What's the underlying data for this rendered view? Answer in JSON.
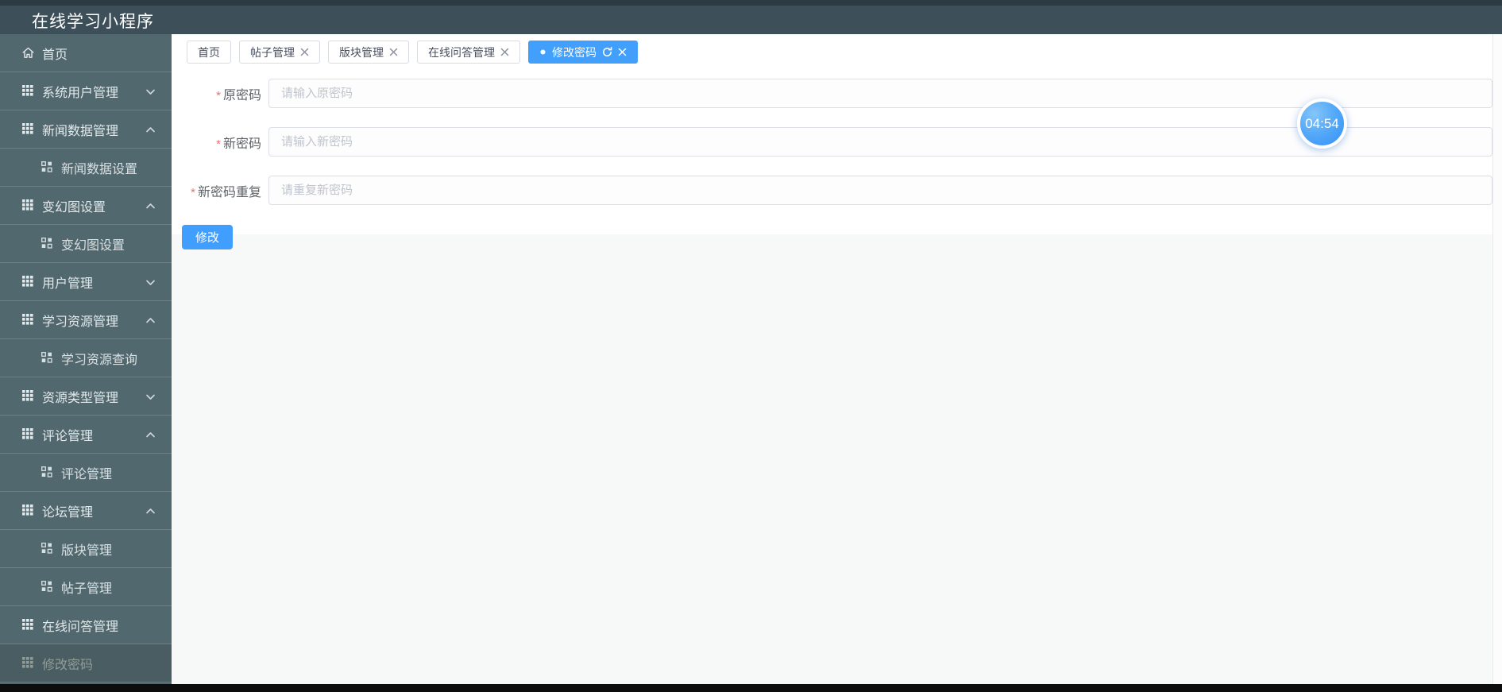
{
  "header": {
    "title": "在线学习小程序"
  },
  "sidebar": {
    "items": [
      {
        "label": "首页",
        "icon": "home",
        "chevron": "",
        "sub": false,
        "dimmed": false
      },
      {
        "label": "系统用户管理",
        "icon": "grid",
        "chevron": "down",
        "sub": false,
        "dimmed": false
      },
      {
        "label": "新闻数据管理",
        "icon": "grid",
        "chevron": "up",
        "sub": false,
        "dimmed": false
      },
      {
        "label": "新闻数据设置",
        "icon": "subgrid",
        "chevron": "",
        "sub": true,
        "dimmed": false
      },
      {
        "label": "变幻图设置",
        "icon": "grid",
        "chevron": "up",
        "sub": false,
        "dimmed": false
      },
      {
        "label": "变幻图设置",
        "icon": "subgrid",
        "chevron": "",
        "sub": true,
        "dimmed": false
      },
      {
        "label": "用户管理",
        "icon": "grid",
        "chevron": "down",
        "sub": false,
        "dimmed": false
      },
      {
        "label": "学习资源管理",
        "icon": "grid",
        "chevron": "up",
        "sub": false,
        "dimmed": false
      },
      {
        "label": "学习资源查询",
        "icon": "subgrid",
        "chevron": "",
        "sub": true,
        "dimmed": false
      },
      {
        "label": "资源类型管理",
        "icon": "grid",
        "chevron": "down",
        "sub": false,
        "dimmed": false
      },
      {
        "label": "评论管理",
        "icon": "grid",
        "chevron": "up",
        "sub": false,
        "dimmed": false
      },
      {
        "label": "评论管理",
        "icon": "subgrid",
        "chevron": "",
        "sub": true,
        "dimmed": false
      },
      {
        "label": "论坛管理",
        "icon": "grid",
        "chevron": "up",
        "sub": false,
        "dimmed": false
      },
      {
        "label": "版块管理",
        "icon": "subgrid",
        "chevron": "",
        "sub": true,
        "dimmed": false
      },
      {
        "label": "帖子管理",
        "icon": "subgrid",
        "chevron": "",
        "sub": true,
        "dimmed": false
      },
      {
        "label": "在线问答管理",
        "icon": "grid",
        "chevron": "",
        "sub": false,
        "dimmed": false
      },
      {
        "label": "修改密码",
        "icon": "grid",
        "chevron": "",
        "sub": false,
        "dimmed": true
      }
    ]
  },
  "tabbar": {
    "tabs": [
      {
        "label": "首页",
        "closable": false,
        "active": false,
        "refresh": false,
        "dot": false
      },
      {
        "label": "帖子管理",
        "closable": true,
        "active": false,
        "refresh": false,
        "dot": false
      },
      {
        "label": "版块管理",
        "closable": true,
        "active": false,
        "refresh": false,
        "dot": false
      },
      {
        "label": "在线问答管理",
        "closable": true,
        "active": false,
        "refresh": false,
        "dot": false
      },
      {
        "label": "修改密码",
        "closable": true,
        "active": true,
        "refresh": true,
        "dot": true
      }
    ]
  },
  "form": {
    "fields": [
      {
        "label": "原密码",
        "required_mark": "*",
        "placeholder": "请输入原密码",
        "value": ""
      },
      {
        "label": "新密码",
        "required_mark": "*",
        "placeholder": "请输入新密码",
        "value": ""
      },
      {
        "label": "新密码重复",
        "required_mark": "*",
        "placeholder": "请重复新密码",
        "value": ""
      }
    ],
    "submit_label": "修改"
  },
  "timer": {
    "value": "04:54"
  },
  "colors": {
    "accent": "#409eff",
    "header_bg": "#3d5059",
    "sidebar_bg": "#52686f",
    "required_mark": "#f56c6c",
    "timer_blue": "#3390f6"
  }
}
